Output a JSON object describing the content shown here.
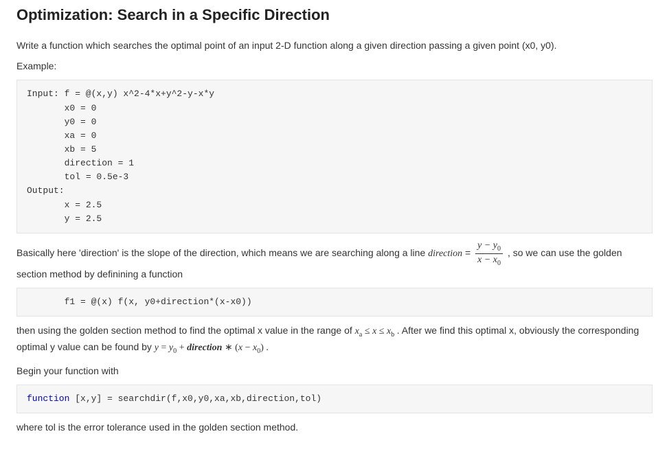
{
  "title": "Optimization: Search in a Specific Direction",
  "intro": "Write a function which searches the optimal point of an input 2-D function along a given direction passing a given point (x0, y0).",
  "example_label": "Example:",
  "code1": "Input: f = @(x,y) x^2-4*x+y^2-y-x*y\n       x0 = 0\n       y0 = 0\n       xa = 0\n       xb = 5\n       direction = 1\n       tol = 0.5e-3\nOutput:\n       x = 2.5\n       y = 2.5",
  "para2_a": "Basically here 'direction' is the slope of the direction, which means we are searching along a line ",
  "para2_dir": "direction",
  "para2_eq": " = ",
  "frac_num_y": "y",
  "frac_num_minus": " − ",
  "frac_num_y0": "y",
  "frac_num_y0_sub": "0",
  "frac_den_x": "x",
  "frac_den_minus": " − ",
  "frac_den_x0": "x",
  "frac_den_x0_sub": "0",
  "para2_b": ", so we can use the golden section method by definining a function",
  "code2": "       f1 = @(x) f(x, y0+direction*(x-x0))",
  "para3_a": "then using the golden section method to find the optimal x value in the range of ",
  "range_xa": "x",
  "range_xa_sub": "a",
  "range_le1": " ≤ ",
  "range_x": "x",
  "range_le2": " ≤ ",
  "range_xb": "x",
  "range_xb_sub": "b",
  "para3_b": ". After we find this optimal x, obviously the corresponding optimal y value can be found by ",
  "eq_y": "y",
  "eq_eq": " = ",
  "eq_y0": "y",
  "eq_y0_sub": "0",
  "eq_plus": " + ",
  "eq_dir": "direction",
  "eq_times": " ∗ (",
  "eq_x": "x",
  "eq_minus": " − ",
  "eq_x0": "x",
  "eq_x0_sub": "0",
  "eq_close": ") .",
  "para4": "Begin your function with",
  "code3_kw": "function",
  "code3_rest": " [x,y] = searchdir(f,x0,y0,xa,xb,direction,tol)",
  "para5": "where tol is the error tolerance used in the golden section method."
}
